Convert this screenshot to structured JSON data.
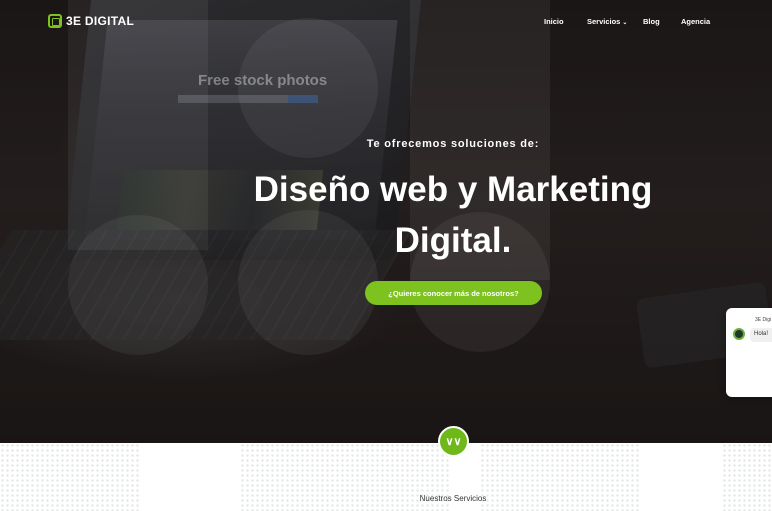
{
  "header": {
    "logo_text": "3E DIGITAL",
    "nav": [
      {
        "label": "Inicio"
      },
      {
        "label": "Servicios",
        "has_dropdown": true
      },
      {
        "label": "Blog"
      },
      {
        "label": "Agencia"
      }
    ]
  },
  "hero": {
    "background_screen_title": "Free stock photos",
    "subtitle": "Te ofrecemos soluciones de:",
    "headline": "Diseño web y Marketing Digital.",
    "cta_label": "¿Quieres conocer más de nosotros?"
  },
  "chat_widget": {
    "agent_name": "3E Digi",
    "message": "Hola! "
  },
  "scroll_icon": "double-chevron-down-icon",
  "services": {
    "title": "Nuestros Servicios"
  },
  "colors": {
    "accent": "#7dc21e",
    "hero_bg": "#231e1d",
    "text_light": "#ffffff"
  }
}
